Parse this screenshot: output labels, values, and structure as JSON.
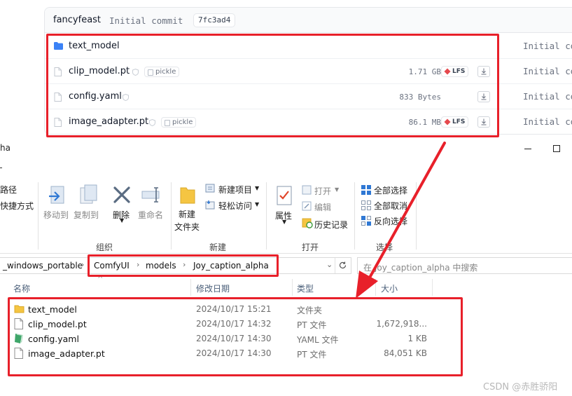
{
  "hf": {
    "user": "fancyfeast",
    "commit_message": "Initial commit",
    "commit_hash": "7fc3ad4",
    "files": [
      {
        "name": "text_model",
        "kind": "folder",
        "size": "",
        "lfs": "",
        "pickle": "",
        "commit": "Initial co"
      },
      {
        "name": "clip_model.pt",
        "kind": "file",
        "size": "1.71 GB",
        "lfs": "LFS",
        "pickle": "pickle",
        "commit": "Initial co"
      },
      {
        "name": "config.yaml",
        "kind": "file",
        "size": "833 Bytes",
        "lfs": "",
        "pickle": "",
        "commit": "Initial co"
      },
      {
        "name": "image_adapter.pt",
        "kind": "file",
        "size": "86.1 MB",
        "lfs": "LFS",
        "pickle": "pickle",
        "commit": "Initial co"
      }
    ]
  },
  "window": {
    "title": "ha"
  },
  "ribbon": {
    "left_cut_1": "路径",
    "left_cut_2": "快捷方式",
    "move_to": "移动到",
    "copy_to": "复制到",
    "delete": "删除",
    "rename": "重命名",
    "group_organize": "组织",
    "new_folder_1": "新建",
    "new_folder_2": "文件夹",
    "new_item": "新建项目",
    "easy_access": "轻松访问",
    "group_new": "新建",
    "properties": "属性",
    "open": "打开",
    "edit": "编辑",
    "history": "历史记录",
    "group_open": "打开",
    "select_all": "全部选择",
    "select_none": "全部取消",
    "invert_selection": "反向选择",
    "group_select": "选择"
  },
  "address": {
    "prefix": "_windows_portable",
    "crumbs": [
      "ComfyUI",
      "models",
      "Joy_caption_alpha"
    ],
    "search_placeholder": "在 Joy_caption_alpha 中搜索"
  },
  "explorer": {
    "columns": {
      "name": "名称",
      "date": "修改日期",
      "type": "类型",
      "size": "大小"
    },
    "rows": [
      {
        "name": "text_model",
        "date": "2024/10/17 15:21",
        "type": "文件夹",
        "size": "",
        "icon": "folder-icon"
      },
      {
        "name": "clip_model.pt",
        "date": "2024/10/17 14:32",
        "type": "PT 文件",
        "size": "1,672,918...",
        "icon": "file-icon"
      },
      {
        "name": "config.yaml",
        "date": "2024/10/17 14:30",
        "type": "YAML 文件",
        "size": "1 KB",
        "icon": "yaml-file-icon"
      },
      {
        "name": "image_adapter.pt",
        "date": "2024/10/17 14:30",
        "type": "PT 文件",
        "size": "84,051 KB",
        "icon": "file-icon"
      }
    ]
  },
  "watermark": "CSDN @赤胜骄阳",
  "colors": {
    "annotation_red": "#e8202a",
    "folder_blue": "#3b82f6",
    "folder_yellow": "#f5c542"
  }
}
